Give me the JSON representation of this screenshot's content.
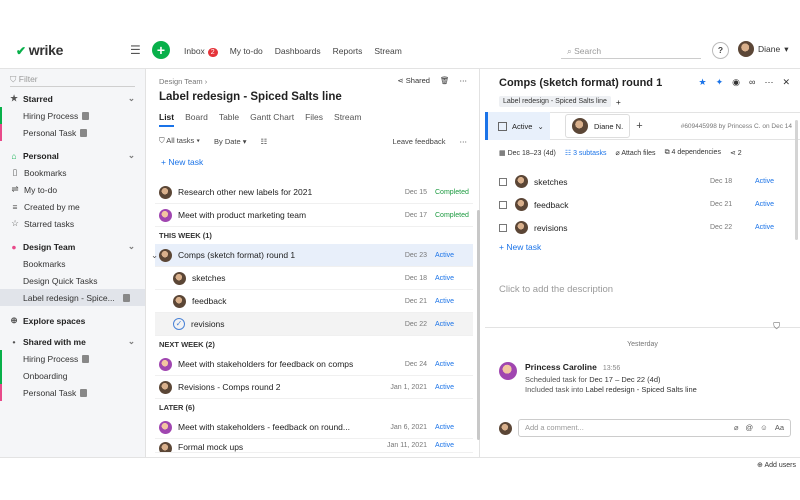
{
  "app": {
    "logo": "wrike"
  },
  "topnav": {
    "inbox": "Inbox",
    "inbox_count": "2",
    "mytodo": "My to-do",
    "dashboards": "Dashboards",
    "reports": "Reports",
    "stream": "Stream",
    "search_placeholder": "Search",
    "help": "?",
    "user": "Diane"
  },
  "sidebar": {
    "filter_placeholder": "Filter",
    "starred": {
      "title": "Starred",
      "items": [
        "Hiring Process",
        "Personal Task"
      ]
    },
    "personal": {
      "title": "Personal",
      "items": [
        "Bookmarks",
        "My to-do",
        "Created by me",
        "Starred tasks"
      ]
    },
    "design_team": {
      "title": "Design Team",
      "items": [
        "Bookmarks",
        "Design Quick Tasks",
        "Label redesign - Spice..."
      ]
    },
    "explore": "Explore spaces",
    "shared": {
      "title": "Shared with me",
      "items": [
        "Hiring Process",
        "Onboarding",
        "Personal Task"
      ]
    }
  },
  "middle": {
    "breadcrumb": "Design Team",
    "title": "Label redesign - Spiced Salts line",
    "shared": "Shared",
    "tabs": [
      "List",
      "Board",
      "Table",
      "Gantt Chart",
      "Files",
      "Stream"
    ],
    "filters": {
      "all_tasks": "All tasks",
      "by_date": "By Date",
      "leave_feedback": "Leave feedback"
    },
    "new_task": "New task",
    "rows": [
      {
        "name": "Research other new labels for 2021",
        "date": "Dec 15",
        "status": "Completed"
      },
      {
        "name": "Meet with product marketing team",
        "date": "Dec 17",
        "status": "Completed"
      }
    ],
    "this_week": "THIS WEEK (1)",
    "this_week_rows": [
      {
        "name": "Comps (sketch format) round 1",
        "date": "Dec 23",
        "status": "Active"
      },
      {
        "name": "sketches",
        "date": "Dec 18",
        "status": "Active"
      },
      {
        "name": "feedback",
        "date": "Dec 21",
        "status": "Active"
      },
      {
        "name": "revisions",
        "date": "Dec 22",
        "status": "Active"
      }
    ],
    "next_week": "NEXT WEEK (2)",
    "next_week_rows": [
      {
        "name": "Meet with stakeholders for feedback on comps",
        "date": "Dec 24",
        "status": "Active"
      },
      {
        "name": "Revisions - Comps round 2",
        "date": "Jan 1, 2021",
        "status": "Active"
      }
    ],
    "later": "LATER (6)",
    "later_rows": [
      {
        "name": "Meet with stakeholders - feedback on round...",
        "date": "Jan 6, 2021",
        "status": "Active"
      },
      {
        "name": "Formal mock ups",
        "date": "Jan 11, 2021",
        "status": "Active"
      }
    ]
  },
  "right": {
    "title": "Comps (sketch format) round 1",
    "parent_chip": "Label redesign - Spiced Salts line",
    "status": "Active",
    "assignee": "Diane N.",
    "meta": "#609445998 by Princess C. on Dec 14",
    "dates": "Dec 18–23 (4d)",
    "subtasks": "3 subtasks",
    "attach": "Attach files",
    "dependencies": "4 dependencies",
    "shares": "2",
    "subtask_rows": [
      {
        "name": "sketches",
        "date": "Dec 18",
        "status": "Active"
      },
      {
        "name": "feedback",
        "date": "Dec 21",
        "status": "Active"
      },
      {
        "name": "revisions",
        "date": "Dec 22",
        "status": "Active"
      }
    ],
    "new_task": "New task",
    "description_placeholder": "Click to add the description",
    "yesterday": "Yesterday",
    "comment": {
      "author": "Princess Caroline",
      "time": "13:56",
      "line1_prefix": "Scheduled task for ",
      "line1_value": "Dec 17 – Dec 22 (4d)",
      "line2_prefix": "Included task into ",
      "line2_value": "Label redesign - Spiced Salts line"
    },
    "comment_placeholder": "Add a comment...",
    "comment_aa": "Aa"
  },
  "footer": {
    "add_users": "Add users"
  },
  "colors": {
    "brand_green": "#08b04a",
    "accent_blue": "#1a73e8",
    "completed": "#1b9a3f"
  }
}
